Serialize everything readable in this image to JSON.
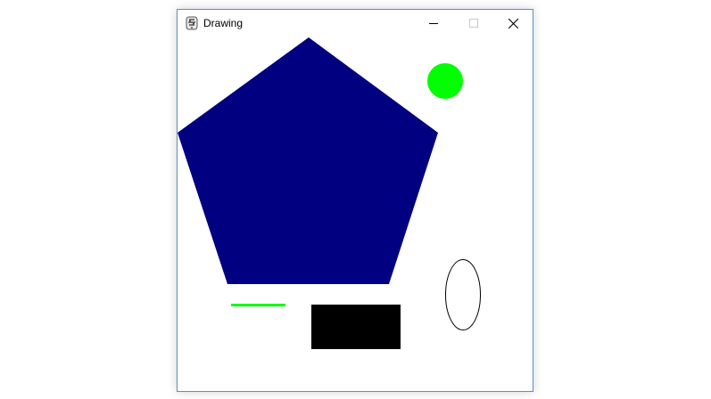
{
  "window": {
    "title": "Drawing",
    "app_icon": "feather-app-icon",
    "controls": {
      "minimize_icon": "minimize-icon",
      "maximize_icon": "maximize-icon",
      "close_icon": "close-icon"
    }
  },
  "canvas": {
    "background": "#ffffff",
    "shapes": [
      {
        "kind": "polygon",
        "name": "pentagon",
        "fill": "#000080"
      },
      {
        "kind": "circle",
        "name": "circle",
        "fill": "#00ff00"
      },
      {
        "kind": "ellipse",
        "name": "ellipse",
        "fill": "none",
        "stroke": "#000000"
      },
      {
        "kind": "line",
        "name": "line",
        "stroke": "#00ff00"
      },
      {
        "kind": "rect",
        "name": "rectangle",
        "fill": "#000000"
      }
    ]
  }
}
